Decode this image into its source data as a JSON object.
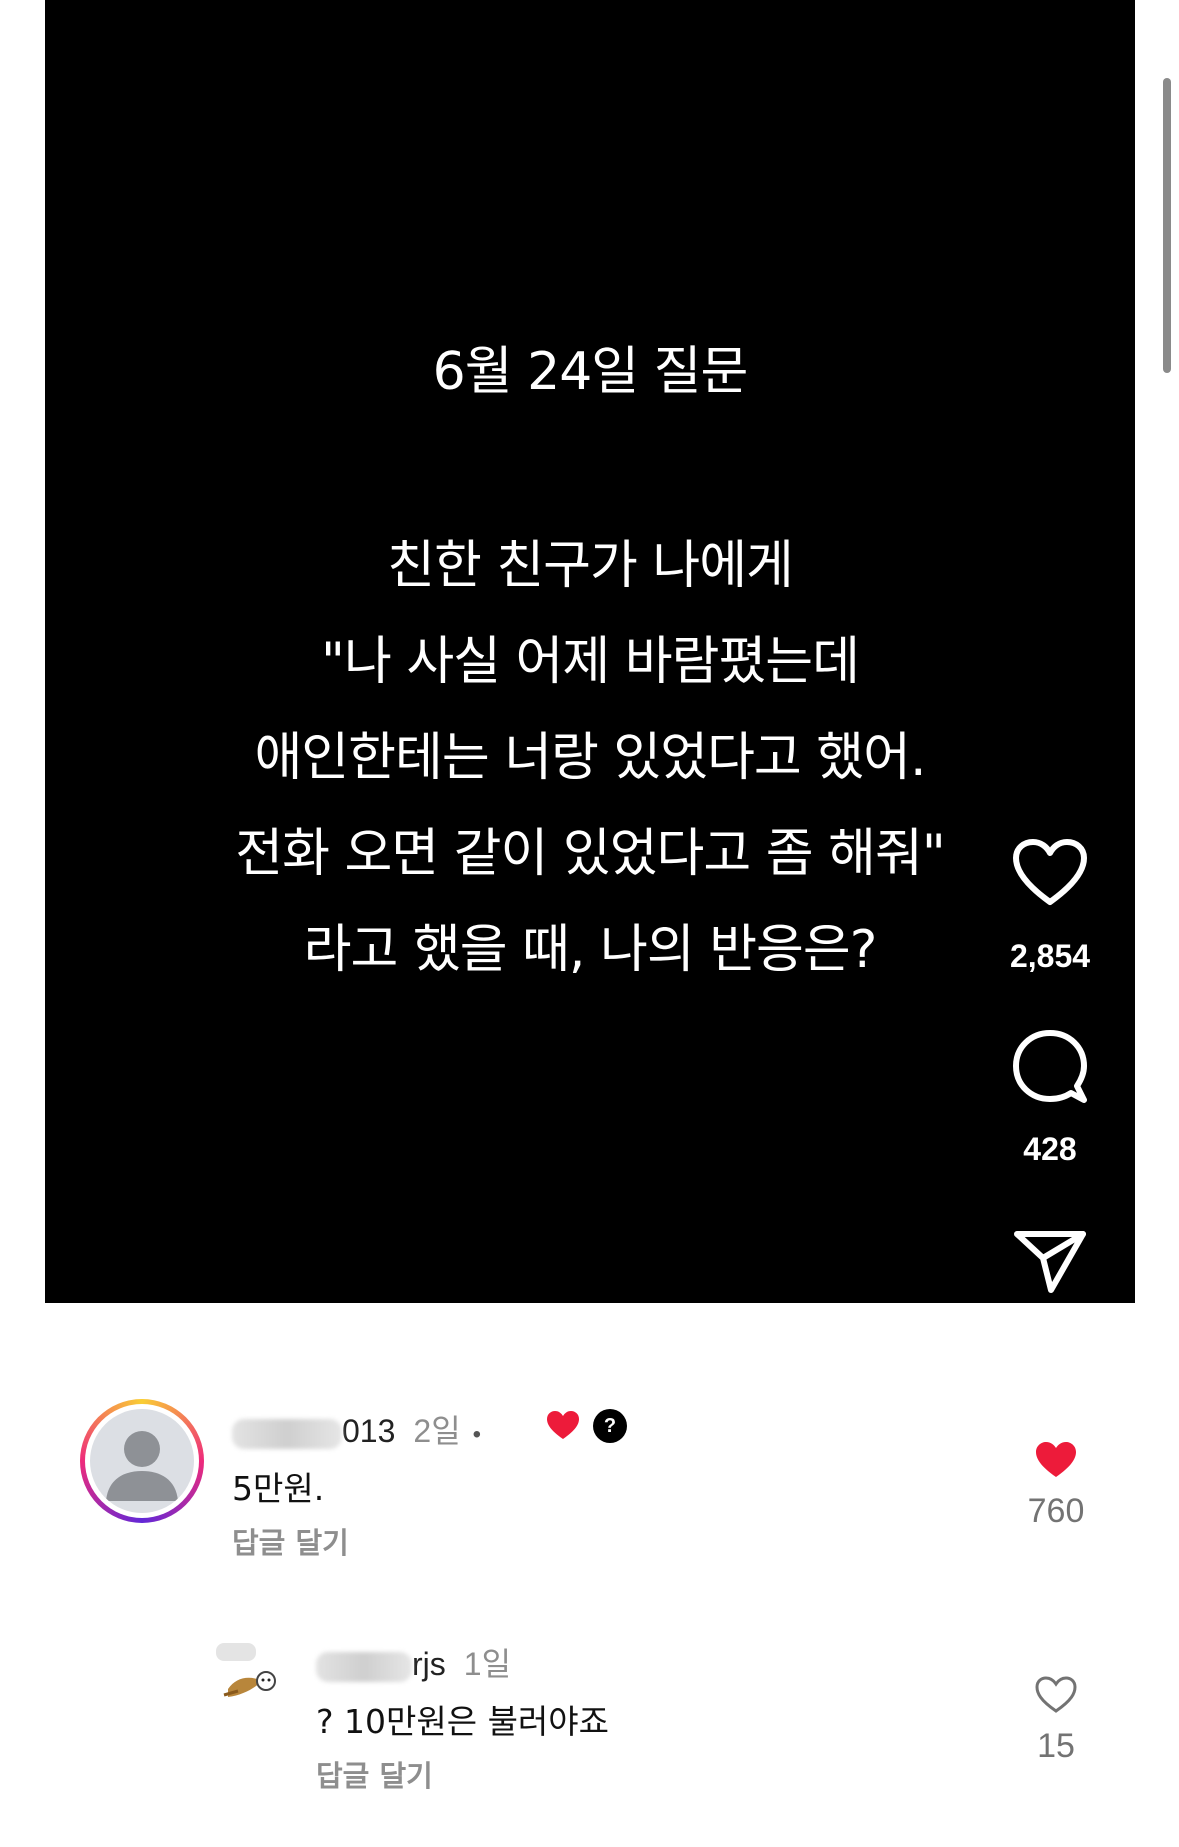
{
  "post": {
    "title": "6월 24일 질문",
    "lines": [
      "친한 친구가 나에게",
      "\"나 사실 어제 바람폈는데",
      "애인한테는 너랑 있었다고 했어.",
      "전화 오면 같이 있었다고 좀 해줘\"",
      "라고 했을 때, 나의 반응은?"
    ],
    "like_count": "2,854",
    "comment_count": "428",
    "icons": {
      "like": "heart-outline-icon",
      "comment": "speech-bubble-icon",
      "share": "paper-plane-icon"
    }
  },
  "comments": [
    {
      "username_visible": "013",
      "time": "2일",
      "separator": "•",
      "author_liked": true,
      "badge": "?",
      "text": "5만원.",
      "reply_label": "답글 달기",
      "like_count": "760",
      "liked": true
    },
    {
      "username_visible": "rjs",
      "time": "1일",
      "text": "? 10만원은 불러야죠",
      "reply_label": "답글 달기",
      "like_count": "15",
      "liked": false
    }
  ],
  "colors": {
    "post_bg": "#000000",
    "like_red": "#ed1b3a",
    "muted": "#8e8e8e"
  }
}
